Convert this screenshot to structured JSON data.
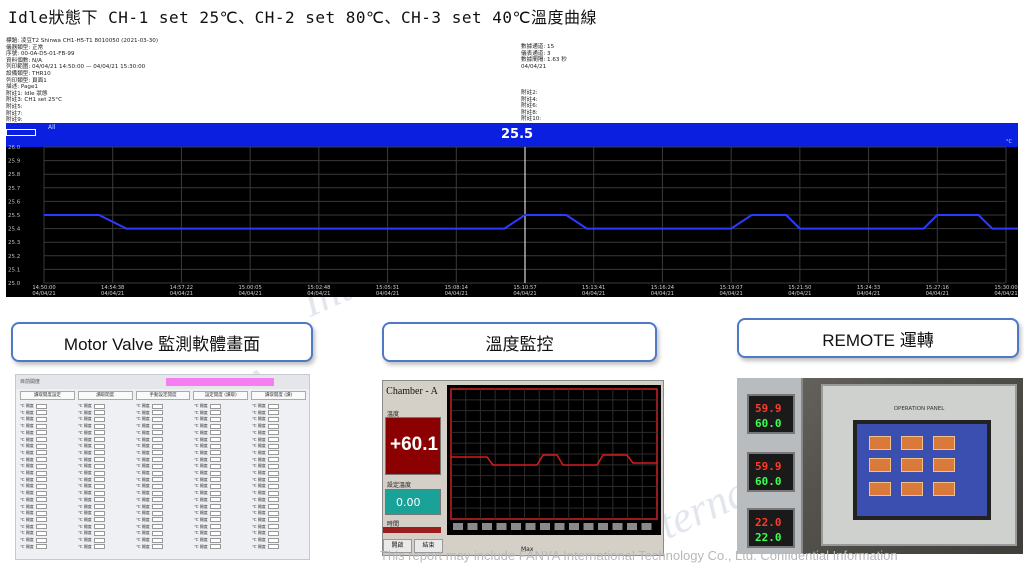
{
  "page_title": "Idle狀態下 CH-1 set 25℃、CH-2 set 80℃、CH-3 set 40℃溫度曲線",
  "watermark_text": "FANYA International",
  "report_header": {
    "left_lines": [
      "標題: 凌豆T2 Shinwa CH1-H5-T1 8010050 (2021-03-30)",
      "儀器類型: 正常",
      "序號: 00-0A-D5-01-FB-99",
      "資料個數: N/A",
      "列印範圍: 04/04/21 14:50:00 — 04/04/21 15:30:00",
      "設備類型: THR10",
      "列印類型: 頁面1",
      "描述: Page1",
      "附註1: Idle 狀態",
      "附註3: CH1 set 25°C",
      "附註5:",
      "附註7:",
      "附註9:"
    ],
    "right_lines": [
      "數據通道: 15",
      "儀表通道: 3",
      "數據間隔: 1.63 秒",
      "04/04/21"
    ],
    "right_notes": [
      "附註2:",
      "附註4:",
      "附註6:",
      "附註8:",
      "附註10:"
    ]
  },
  "chart_data": {
    "type": "line",
    "banner_label": "All",
    "current_value": "25.5",
    "unit": "°C",
    "ylim": [
      25.0,
      26.0
    ],
    "y_ticks": [
      "26.0",
      "25.9",
      "25.8",
      "25.7",
      "25.6",
      "25.5",
      "25.4",
      "25.3",
      "25.2",
      "25.1",
      "25.0"
    ],
    "x_ticks": [
      {
        "time": "14:50:00",
        "date": "04/04/21"
      },
      {
        "time": "14:54:38",
        "date": "04/04/21"
      },
      {
        "time": "14:57:22",
        "date": "04/04/21"
      },
      {
        "time": "15:00:05",
        "date": "04/04/21"
      },
      {
        "time": "15:02:48",
        "date": "04/04/21"
      },
      {
        "time": "15:05:31",
        "date": "04/04/21"
      },
      {
        "time": "15:08:14",
        "date": "04/04/21"
      },
      {
        "time": "15:10:57",
        "date": "04/04/21"
      },
      {
        "time": "15:13:41",
        "date": "04/04/21"
      },
      {
        "time": "15:16:24",
        "date": "04/04/21"
      },
      {
        "time": "15:19:07",
        "date": "04/04/21"
      },
      {
        "time": "15:21:50",
        "date": "04/04/21"
      },
      {
        "time": "15:24:33",
        "date": "04/04/21"
      },
      {
        "time": "15:27:16",
        "date": "04/04/21"
      },
      {
        "time": "15:30:00",
        "date": "04/04/21"
      }
    ],
    "series": [
      {
        "color": "#2b3bff",
        "points": [
          [
            0,
            25.5
          ],
          [
            0.8,
            25.5
          ],
          [
            1.2,
            25.4
          ],
          [
            6.7,
            25.4
          ],
          [
            7.0,
            25.5
          ],
          [
            7.6,
            25.5
          ],
          [
            7.9,
            25.4
          ],
          [
            10.0,
            25.4
          ],
          [
            10.3,
            25.5
          ],
          [
            10.8,
            25.5
          ],
          [
            11.0,
            25.4
          ],
          [
            12.8,
            25.4
          ],
          [
            13.0,
            25.5
          ],
          [
            13.6,
            25.5
          ],
          [
            13.8,
            25.4
          ],
          [
            14.9,
            25.4
          ]
        ]
      }
    ],
    "grid": true
  },
  "sections": {
    "motor_valve": "Motor Valve 監測軟體畫面",
    "temp_monitor": "溫度監控",
    "remote": "REMOTE 運轉"
  },
  "motor_valve_ui": {
    "top_label": "目前開度",
    "buttons": [
      "讀取開度設定",
      "讀取開度",
      "手動設定開度",
      "設定開度 (讀取)",
      "讀取開度 (讀)"
    ],
    "cell_label": "℃ 開度"
  },
  "temp_monitor_ui": {
    "chamber_title": "Chamber - A",
    "temp_label": "溫度",
    "temp_value": "+60.1",
    "set_label": "設定溫度",
    "set_value": "0.00",
    "time_label": "時間",
    "tab1": "開啟",
    "tab2": "結束",
    "max_label": "Max"
  },
  "remote_ui": {
    "panel_title": "OPERATION PANEL",
    "ctrl1_top": "59.9",
    "ctrl1_bottom": "60.0",
    "ctrl2_top": "59.9",
    "ctrl2_bottom": "60.0",
    "ctrl3_top": "22.0",
    "ctrl3_bottom": "22.0"
  },
  "footer_note": "This report may include FANYA International Technology Co., Ltd. Confidential Information"
}
